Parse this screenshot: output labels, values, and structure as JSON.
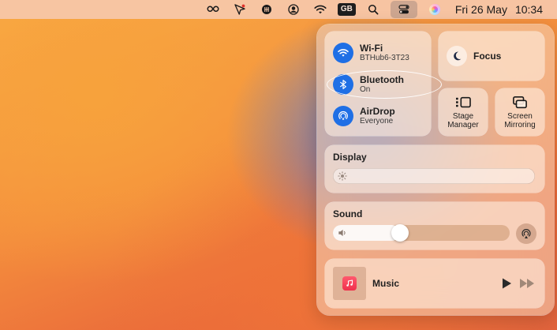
{
  "menubar": {
    "icons": [
      "creative-cloud-icon",
      "pen-cursor-icon",
      "brain-icon",
      "user-account-icon",
      "wifi-icon",
      "keyboard-layout-badge",
      "search-icon",
      "control-center-icon",
      "siri-icon"
    ],
    "input_source": "GB",
    "date": "Fri 26 May",
    "time": "10:34"
  },
  "control_center": {
    "wifi": {
      "title": "Wi-Fi",
      "subtitle": "BTHub6-3T23"
    },
    "bluetooth": {
      "title": "Bluetooth",
      "subtitle": "On"
    },
    "airdrop": {
      "title": "AirDrop",
      "subtitle": "Everyone"
    },
    "focus": {
      "label": "Focus"
    },
    "stage_manager": {
      "line1": "Stage",
      "line2": "Manager"
    },
    "screen_mirroring": {
      "line1": "Screen",
      "line2": "Mirroring"
    },
    "display": {
      "label": "Display",
      "brightness_percent": 0
    },
    "sound": {
      "label": "Sound",
      "volume_percent": 38
    },
    "music": {
      "label": "Music"
    }
  },
  "colors": {
    "accent_blue": "#1f6fe5",
    "music_red": "#f0304c"
  }
}
